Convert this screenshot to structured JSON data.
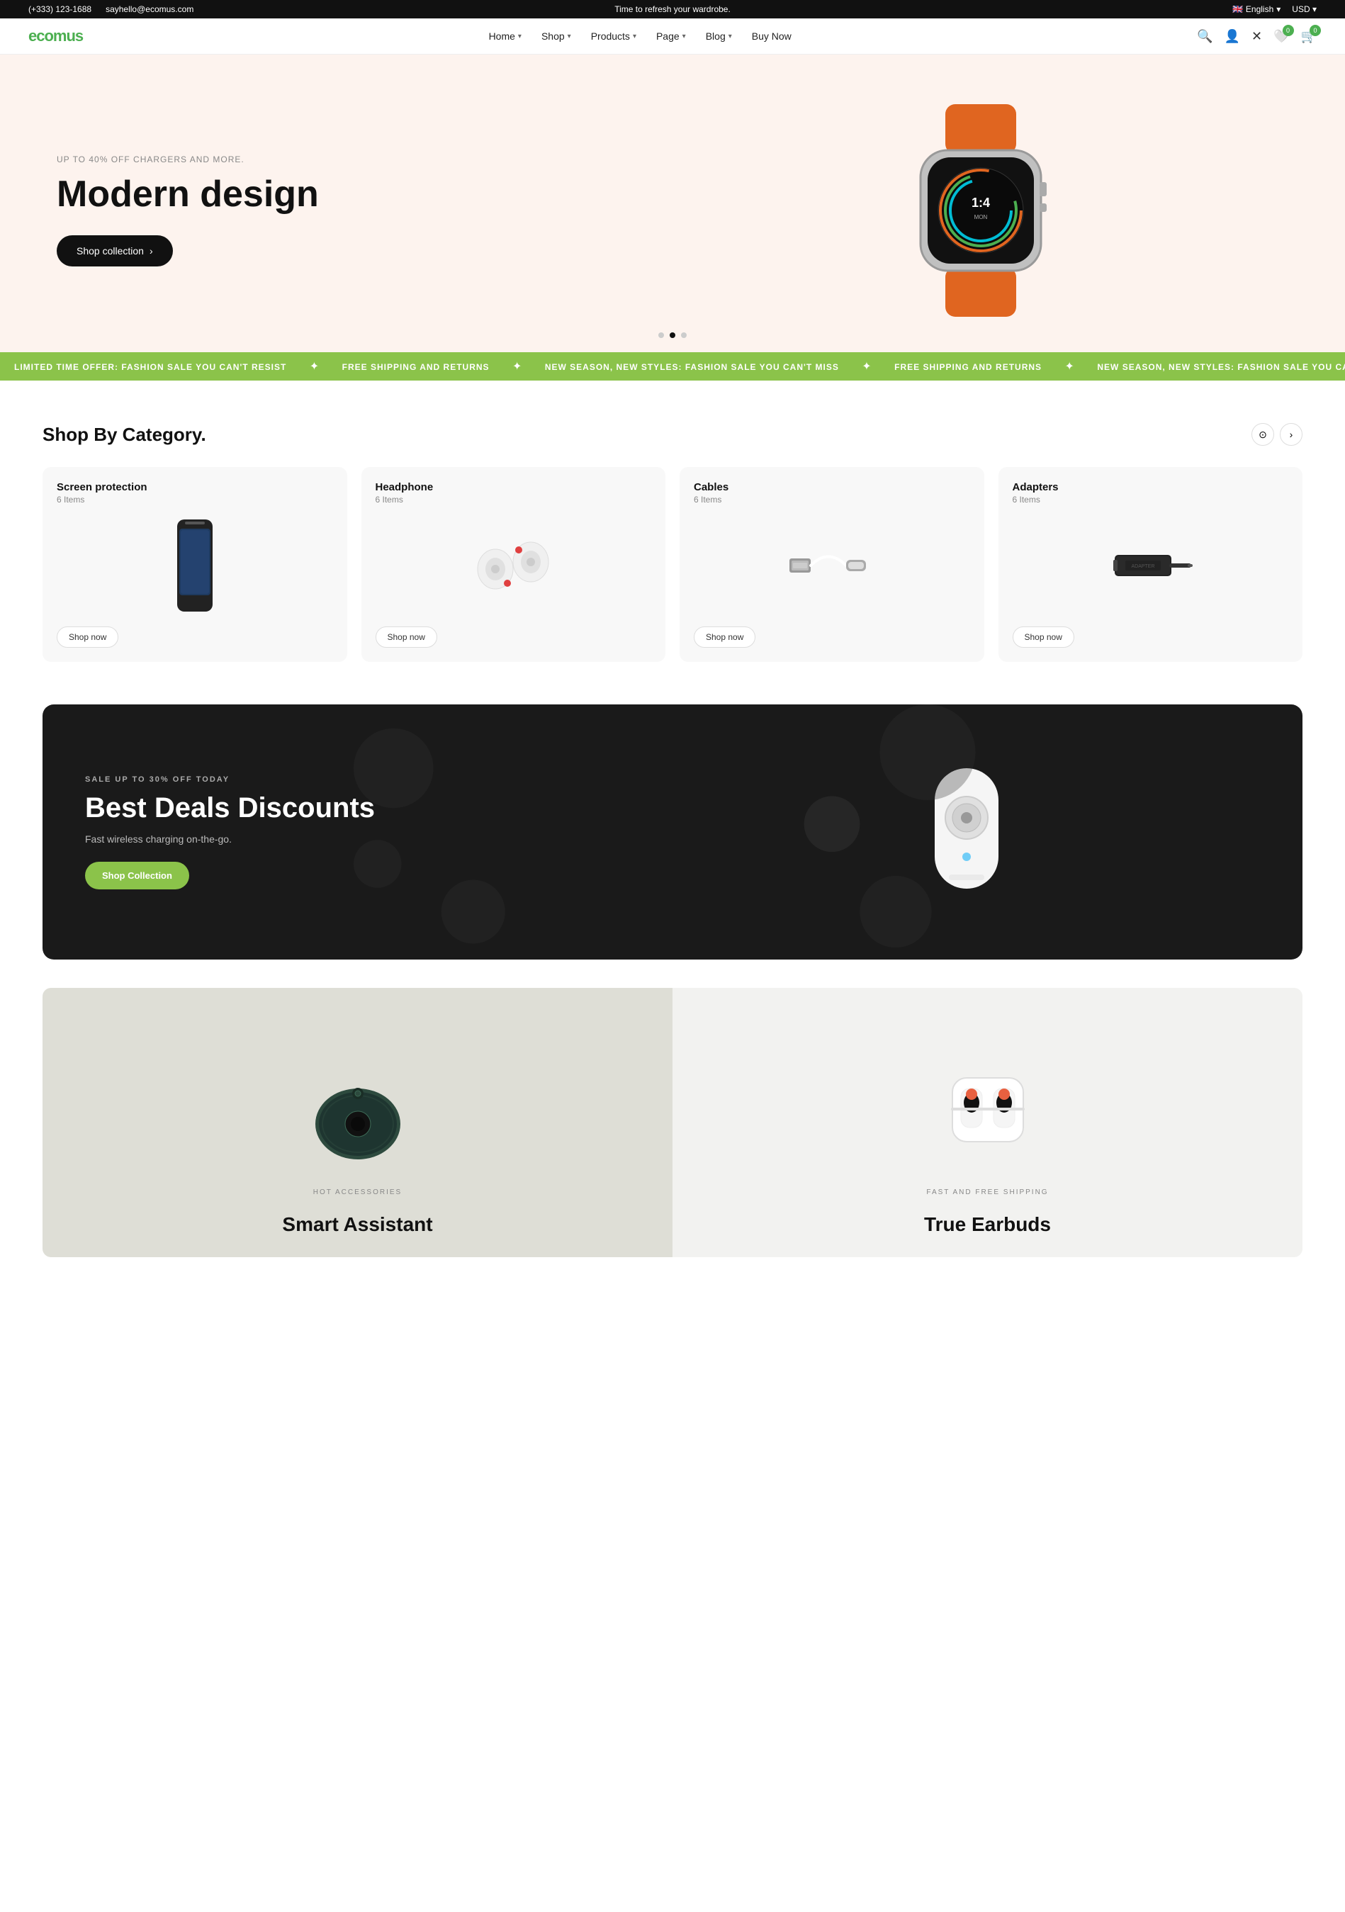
{
  "topbar": {
    "phone": "(+333) 123-1688",
    "email": "sayhello@ecomus.com",
    "promo": "Time to refresh your wardrobe.",
    "language": "English",
    "currency": "USD"
  },
  "navbar": {
    "logo": "ecomus",
    "links": [
      {
        "label": "Home",
        "hasDropdown": true
      },
      {
        "label": "Shop",
        "hasDropdown": true
      },
      {
        "label": "Products",
        "hasDropdown": true
      },
      {
        "label": "Page",
        "hasDropdown": true
      },
      {
        "label": "Blog",
        "hasDropdown": true
      },
      {
        "label": "Buy Now",
        "hasDropdown": false
      }
    ],
    "cart_count": "0",
    "wishlist_count": "0"
  },
  "hero": {
    "subtitle": "UP TO 40% OFF CHARGERS AND MORE.",
    "title": "Modern design",
    "cta": "Shop collection",
    "dots": [
      1,
      2,
      3
    ],
    "active_dot": 1
  },
  "marquee": {
    "items": [
      "LIMITED TIME OFFER: FASHION SALE YOU CAN'T RESIST",
      "FREE SHIPPING AND RETURNS",
      "NEW SEASON, NEW STYLES: FASHION SALE YOU CAN'T MISS",
      "FREE SHIPPING AND RETURNS",
      "NEW SEASON, NEW STYLES: FASHION SALE YOU CAN'T MISS",
      "LIMITED TIME OFFER: FASHION SALE YOU CAN'T RESIST",
      "FREE SHIPPING AND RETURNS",
      "NEW SEASON, NEW STYLES: FASHION SALE YOU CAN'T MISS",
      "FREE SHIPPING AND RETURNS"
    ]
  },
  "category_section": {
    "title": "Shop By Category.",
    "categories": [
      {
        "name": "Screen protection",
        "items": "6 Items",
        "cta": "Shop now"
      },
      {
        "name": "Headphone",
        "items": "6 Items",
        "cta": "Shop now"
      },
      {
        "name": "Cables",
        "items": "6 Items",
        "cta": "Shop now"
      },
      {
        "name": "Adapters",
        "items": "6 Items",
        "cta": "Shop now"
      }
    ]
  },
  "deals_banner": {
    "tag": "SALE UP TO 30% OFF TODAY",
    "title": "Best Deals Discounts",
    "subtitle": "Fast wireless charging on-the-go.",
    "cta": "Shop Collection"
  },
  "panels": [
    {
      "tag": "HOT ACCESSORIES",
      "title": "Smart Assistant"
    },
    {
      "tag": "FAST AND FREE SHIPPING",
      "title": "True Earbuds"
    }
  ]
}
